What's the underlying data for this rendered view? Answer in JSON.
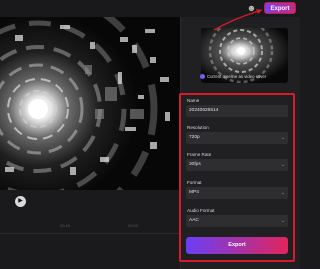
{
  "topbar": {
    "export_label": "Export"
  },
  "preview": {
    "play_icon": "play-icon"
  },
  "timeline": {
    "ticks": [
      "00:15",
      "00:20"
    ]
  },
  "panel": {
    "cover_option_label": "Current timeline as video cover",
    "fields": {
      "name": {
        "label": "Name",
        "value": "20240626514"
      },
      "resolution": {
        "label": "Resolution",
        "value": "720p"
      },
      "frame_rate": {
        "label": "Frame Rate",
        "value": "30fps"
      },
      "format": {
        "label": "Format",
        "value": "MP4"
      },
      "audio_format": {
        "label": "Audio Format",
        "value": "AAC"
      }
    },
    "export_button_label": "Export"
  },
  "colors": {
    "accent_gradient_start": "#6a3ff5",
    "accent_gradient_end": "#e0255d",
    "annotation_red": "#d61b2a"
  }
}
